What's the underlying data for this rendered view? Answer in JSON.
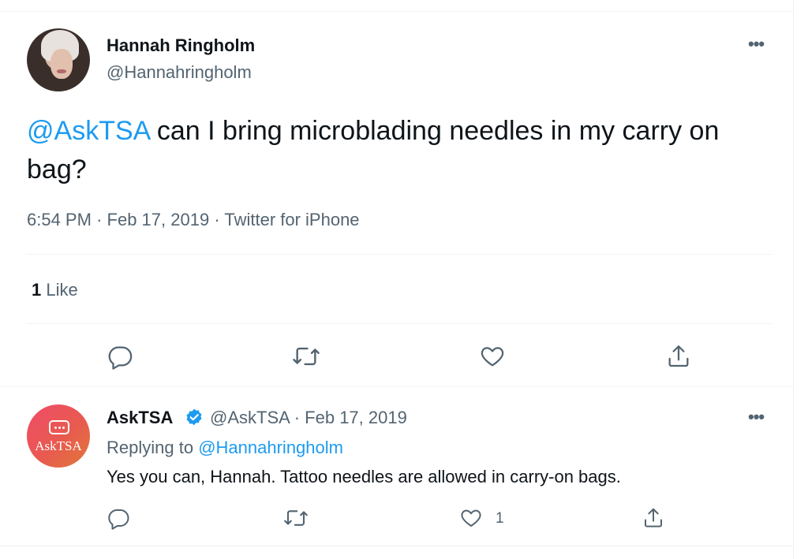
{
  "tweet": {
    "author_name": "Hannah Ringholm",
    "author_handle": "@Hannahringholm",
    "mention": "@AskTSA",
    "text": " can I bring microblading needles in my carry on bag?",
    "time": "6:54 PM",
    "sep1": "·",
    "date": "Feb 17, 2019",
    "sep2": "·",
    "source": "Twitter for iPhone",
    "likes_count": "1",
    "likes_label": "Like",
    "more_label": "•••"
  },
  "reply": {
    "author_name": "AskTSA",
    "author_handle": "@AskTSA",
    "sep": "·",
    "date": "Feb 17, 2019",
    "replying_prefix": "Replying to",
    "replying_to": "@Hannahringholm",
    "text": "Yes you can, Hannah. Tattoo needles are allowed in carry-on bags.",
    "like_count": "1",
    "avatar_text": "AskTSA",
    "more_label": "•••"
  },
  "colors": {
    "accent": "#1d9bf0",
    "text": "#0f1419",
    "muted": "#536471",
    "verified": "#1d9bf0"
  },
  "icons": [
    "reply-icon",
    "retweet-icon",
    "like-icon",
    "share-icon",
    "more-icon",
    "verified-badge-icon"
  ]
}
